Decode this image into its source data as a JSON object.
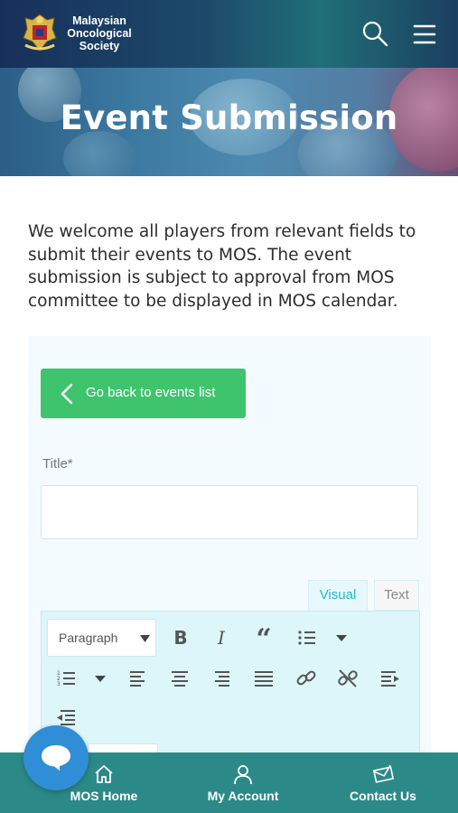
{
  "header": {
    "org_name": "Malaysian Oncological Society",
    "org_name_lines": [
      "Malaysian",
      "Oncological",
      "Society"
    ],
    "icons": [
      "logo-crest",
      "search-icon",
      "menu-icon"
    ]
  },
  "hero": {
    "title": "Event Submission"
  },
  "intro": {
    "text": "We welcome all players from relevant fields to submit their events to MOS. The event submission is subject to approval from MOS committee to be displayed in MOS calendar."
  },
  "form": {
    "back_button_label": "Go back to events list",
    "title_label": "Title*",
    "title_value": "",
    "editor": {
      "tabs": [
        {
          "label": "Visual",
          "active": true
        },
        {
          "label": "Text",
          "active": false
        }
      ],
      "format_select": "Paragraph",
      "toolbar_row1": [
        "bold-icon",
        "italic-icon",
        "blockquote-icon",
        "bullet-list-icon",
        "chevron-down-icon"
      ],
      "toolbar_row2": [
        "numbered-list-icon",
        "chevron-down-icon",
        "align-left-icon",
        "align-center-icon",
        "align-right-icon",
        "align-justify-icon",
        "link-icon",
        "unlink-icon",
        "indent-icon"
      ],
      "toolbar_row3": [
        "outdent-icon"
      ],
      "bold_glyph": "B",
      "italic_glyph": "I",
      "quote_glyph": "“"
    }
  },
  "bottom_nav": {
    "items": [
      {
        "label": "MOS Home",
        "icon": "home-icon"
      },
      {
        "label": "My Account",
        "icon": "user-icon"
      },
      {
        "label": "Contact Us",
        "icon": "contact-envelope-icon"
      }
    ]
  },
  "colors": {
    "header_bg": "#17305a",
    "accent_green": "#3ec46d",
    "nav_bg": "#2b8a88",
    "chat_blue": "#2f8ed6",
    "tab_active_text": "#26b7c6"
  }
}
